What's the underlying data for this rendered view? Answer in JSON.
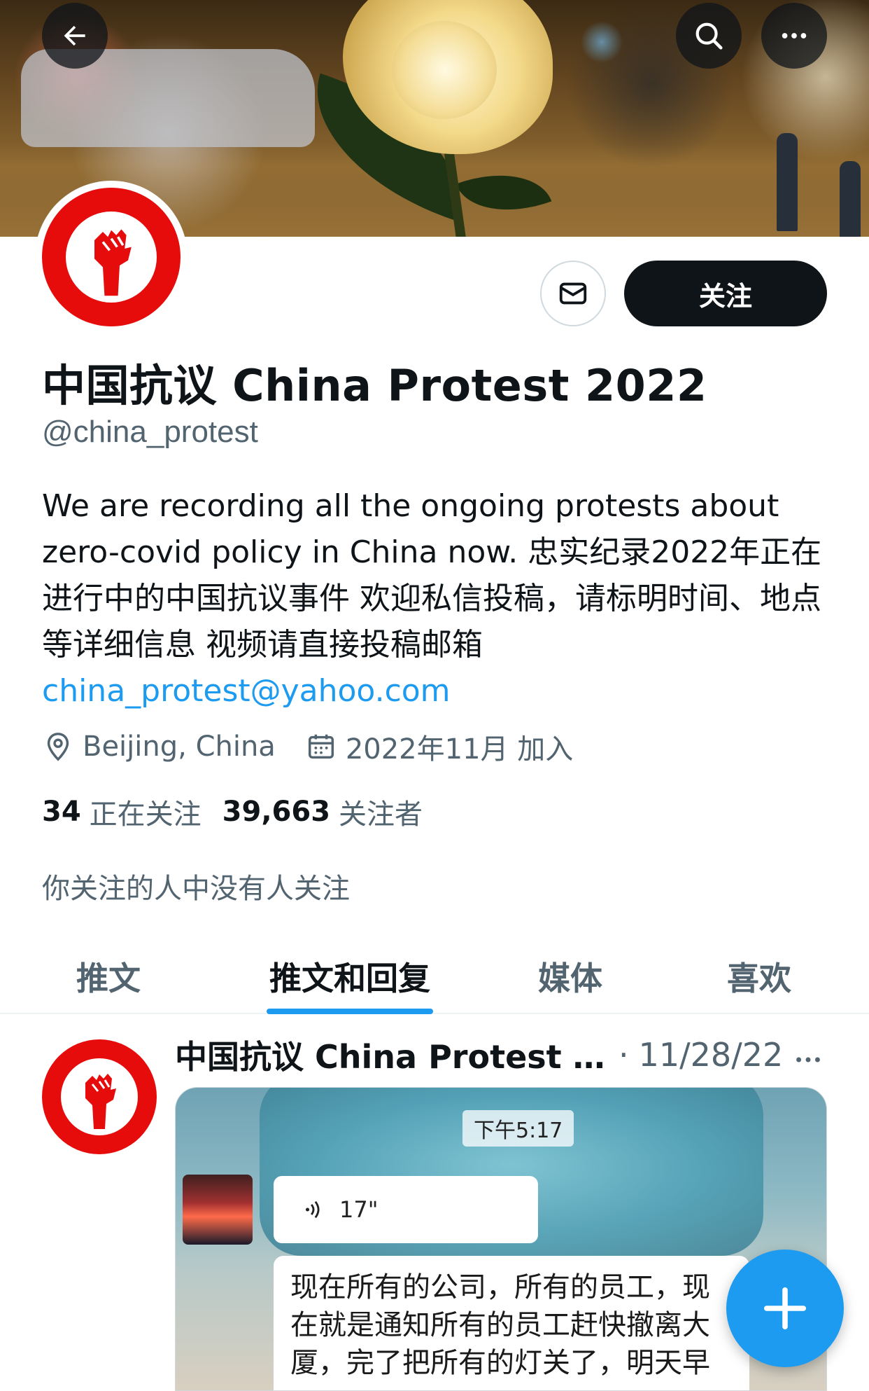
{
  "header": {
    "back_icon": "arrow-left-icon",
    "search_icon": "search-icon",
    "more_icon": "more-horizontal-icon"
  },
  "profile": {
    "display_name": "中国抗议 China Protest 2022",
    "handle": "@china_protest",
    "bio": "We are recording all the ongoing protests about zero-covid policy in China now. 忠实纪录2022年正在进行中的中国抗议事件 欢迎私信投稿，请标明时间、地点等详细信息 视频请直接投稿邮箱",
    "bio_link": "china_protest@yahoo.com",
    "location": "Beijing, China",
    "joined": "2022年11月 加入",
    "following_count": "34",
    "following_label": "正在关注",
    "followers_count": "39,663",
    "followers_label": "关注者",
    "followed_by_note": "你关注的人中没有人关注"
  },
  "actions": {
    "message_icon": "envelope-icon",
    "follow_label": "关注"
  },
  "tabs": [
    {
      "label": "推文",
      "active": false
    },
    {
      "label": "推文和回复",
      "active": true
    },
    {
      "label": "媒体",
      "active": false
    },
    {
      "label": "喜欢",
      "active": false
    }
  ],
  "tweet": {
    "author": "中国抗议 China Protest 20...",
    "separator": "·",
    "date": "11/28/22",
    "media": {
      "time_chip": "下午5:17",
      "voice_duration": "17\"",
      "message_text": "现在所有的公司，所有的员工，现在就是通知所有的员工赶快撤离大厦，完了把所有的灯关了，明天早"
    }
  },
  "colors": {
    "accent": "#1d9bf0",
    "text_primary": "#0f1419",
    "text_secondary": "#536471",
    "avatar_red": "#e60c0c"
  },
  "fab": {
    "icon": "plus-icon"
  }
}
